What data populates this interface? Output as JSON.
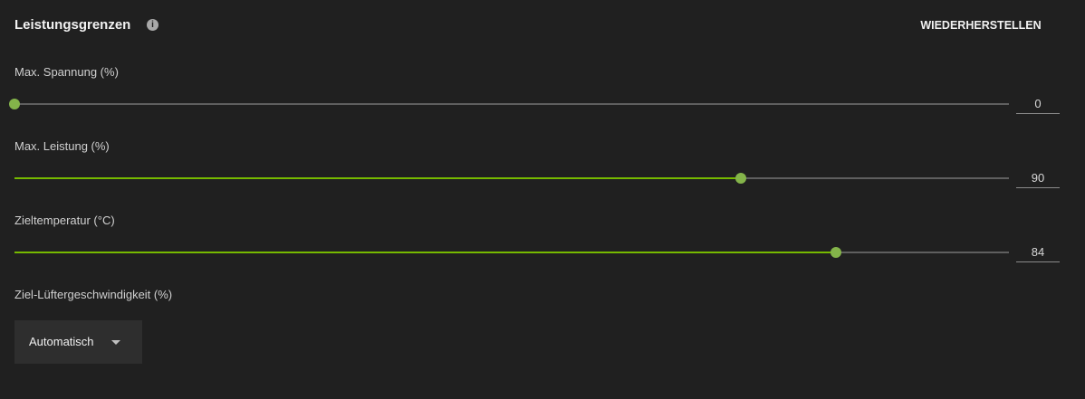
{
  "header": {
    "title": "Leistungsgrenzen",
    "info_icon": "info-icon",
    "reset_label": "WIEDERHERSTELLEN"
  },
  "colors": {
    "background": "#202020",
    "accent": "#76b900",
    "thumb": "#84b44a",
    "track": "#5f5f5f"
  },
  "sliders": [
    {
      "id": "voltage",
      "label": "Max. Spannung (%)",
      "value": "0",
      "level": 0.0
    },
    {
      "id": "power",
      "label": "Max. Leistung (%)",
      "value": "90",
      "level": 0.73
    },
    {
      "id": "temperature",
      "label": "Zieltemperatur (°C)",
      "value": "84",
      "level": 0.826
    }
  ],
  "fan": {
    "label": "Ziel-Lüftergeschwindigkeit (%)",
    "selected": "Automatisch",
    "icon": "chevron-down-icon"
  }
}
